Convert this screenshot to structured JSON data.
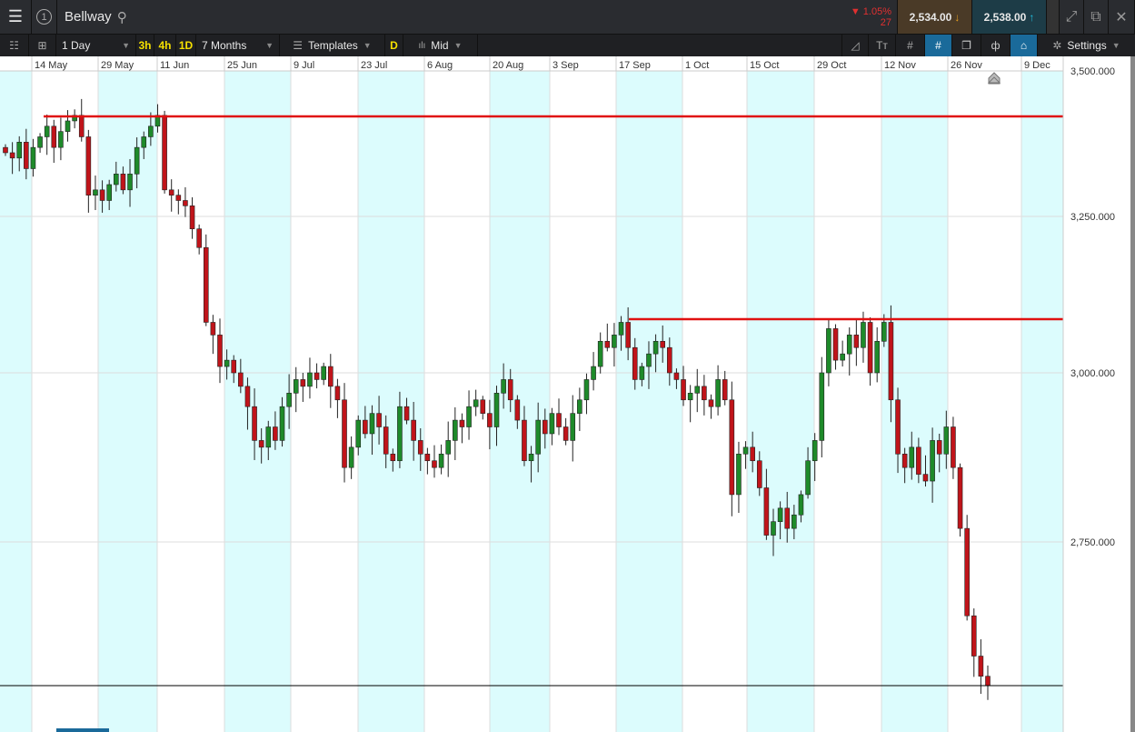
{
  "header": {
    "instrument": "Bellway",
    "change_pct": "1.05%",
    "change_pts": "27",
    "sell_price": "2,534.00",
    "buy_price": "2,538.00",
    "slot": "1"
  },
  "toolbar": {
    "interval": "1 Day",
    "quick": [
      "3h",
      "4h",
      "1D"
    ],
    "range": "7 Months",
    "templates": "Templates",
    "d_label": "D",
    "price_type": "Mid",
    "settings": "Settings"
  },
  "colors": {
    "up": "#1e8a2a",
    "down": "#c0141a",
    "line": "#e01010",
    "band": "#dcfcfd"
  },
  "chart_data": {
    "type": "candlestick",
    "title": "Bellway",
    "x_ticks": [
      "14 May",
      "29 May",
      "11 Jun",
      "25 Jun",
      "9 Jul",
      "23 Jul",
      "6 Aug",
      "20 Aug",
      "3 Sep",
      "17 Sep",
      "1 Oct",
      "15 Oct",
      "29 Oct",
      "12 Nov",
      "26 Nov",
      "9 Dec"
    ],
    "y_ticks": [
      {
        "v": 3500,
        "label": "3,500.000"
      },
      {
        "v": 3250,
        "label": "3,250.000"
      },
      {
        "v": 3000,
        "label": "3,000.000"
      },
      {
        "v": 2750,
        "label": "2,750.000"
      }
    ],
    "ylim": [
      2500,
      3520
    ],
    "hlines": [
      {
        "value": 3438.5,
        "label": "3,438.500",
        "color": "#e01010"
      },
      {
        "value": 3085,
        "label": "3,085.000",
        "color": "#e01010"
      },
      {
        "value": 2536,
        "label": "2,536.000",
        "color": "#000000",
        "current": true
      }
    ],
    "first_open": 3380,
    "closes": [
      3370,
      3360,
      3390,
      3340,
      3380,
      3400,
      3420,
      3380,
      3410,
      3430,
      3440,
      3400,
      3290,
      3300,
      3280,
      3310,
      3330,
      3300,
      3330,
      3380,
      3400,
      3420,
      3440,
      3300,
      3290,
      3280,
      3270,
      3230,
      3200,
      3080,
      3060,
      3010,
      3020,
      3000,
      2980,
      2950,
      2900,
      2890,
      2920,
      2900,
      2950,
      2970,
      2990,
      2980,
      3000,
      2990,
      3010,
      2980,
      2960,
      2860,
      2890,
      2930,
      2910,
      2940,
      2920,
      2880,
      2870,
      2950,
      2930,
      2900,
      2880,
      2870,
      2860,
      2880,
      2900,
      2930,
      2920,
      2950,
      2960,
      2940,
      2920,
      2970,
      2990,
      2960,
      2930,
      2870,
      2880,
      2930,
      2910,
      2940,
      2920,
      2900,
      2940,
      2960,
      2990,
      3010,
      3050,
      3040,
      3060,
      3080,
      3040,
      2990,
      3010,
      3030,
      3050,
      3040,
      3000,
      2990,
      2960,
      2970,
      2980,
      2960,
      2950,
      2990,
      2960,
      2820,
      2880,
      2890,
      2870,
      2830,
      2760,
      2780,
      2800,
      2770,
      2790,
      2820,
      2870,
      2900,
      3000,
      3070,
      3020,
      3030,
      3060,
      3040,
      3080,
      3000,
      3050,
      3080,
      2960,
      2880,
      2860,
      2890,
      2850,
      2840,
      2900,
      2880,
      2920,
      2860,
      2770,
      2640,
      2580,
      2550,
      2536
    ]
  }
}
